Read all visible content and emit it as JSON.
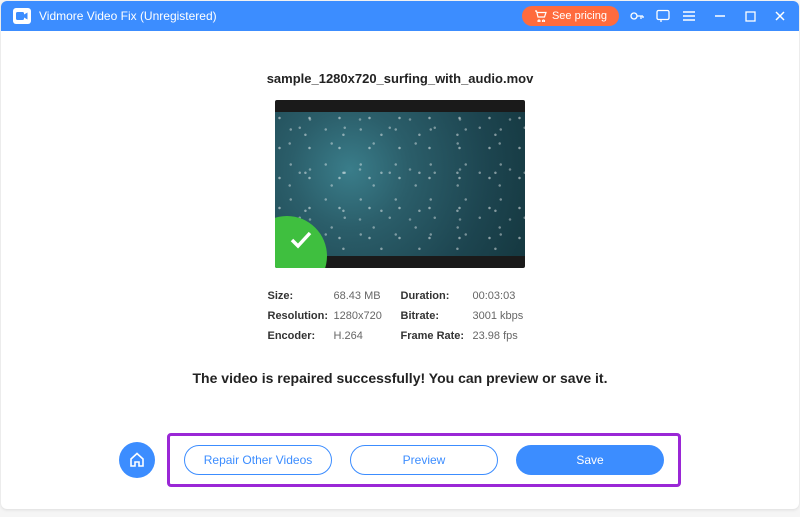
{
  "titlebar": {
    "title": "Vidmore Video Fix (Unregistered)",
    "see_pricing": "See pricing"
  },
  "file": {
    "name": "sample_1280x720_surfing_with_audio.mov"
  },
  "info": {
    "size_label": "Size:",
    "size_value": "68.43 MB",
    "duration_label": "Duration:",
    "duration_value": "00:03:03",
    "resolution_label": "Resolution:",
    "resolution_value": "1280x720",
    "bitrate_label": "Bitrate:",
    "bitrate_value": "3001 kbps",
    "encoder_label": "Encoder:",
    "encoder_value": "H.264",
    "framerate_label": "Frame Rate:",
    "framerate_value": "23.98 fps"
  },
  "message": "The video is repaired successfully! You can preview or save it.",
  "buttons": {
    "repair_other": "Repair Other Videos",
    "preview": "Preview",
    "save": "Save"
  }
}
